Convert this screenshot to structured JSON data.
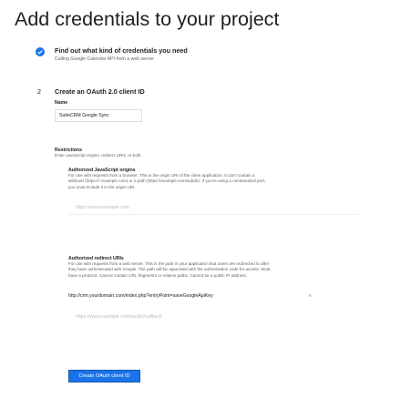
{
  "page_title": "Add credentials to your project",
  "step1": {
    "title": "Find out what kind of credentials you need",
    "subtitle": "Calling Google Calendar API from a web server"
  },
  "step2": {
    "number": "2",
    "title": "Create an OAuth 2.0 client ID",
    "name_label": "Name",
    "name_value": "SuiteCRM Google Sync",
    "restrictions_label": "Restrictions",
    "restrictions_help": "Enter JavaScript origins, redirect URIs, or both",
    "js_origins": {
      "label": "Authorized JavaScript origins",
      "help": "For use with requests from a browser. This is the origin URI of the client application. It can't contain a wildcard (https://*.example.com) or a path (https://example.com/subdir). If you're using a nonstandard port, you must include it in the origin URI.",
      "placeholder": "https://www.example.com"
    },
    "redirect_uris": {
      "label": "Authorized redirect URIs",
      "help": "For use with requests from a web server. This is the path in your application that users are redirected to after they have authenticated with Google. The path will be appended with the authorization code for access. Must have a protocol. Cannot contain URL fragments or relative paths. Cannot be a public IP address.",
      "value": "http://crm.yourdomain.com/index.php?entryPoint=saveGoogleApiKey",
      "remove_icon": "×",
      "placeholder": "https://www.example.com/oauth2callback"
    },
    "create_button": "Create OAuth client ID"
  },
  "colors": {
    "accent": "#1a73e8",
    "text": "#202124",
    "muted": "#5f6368"
  }
}
